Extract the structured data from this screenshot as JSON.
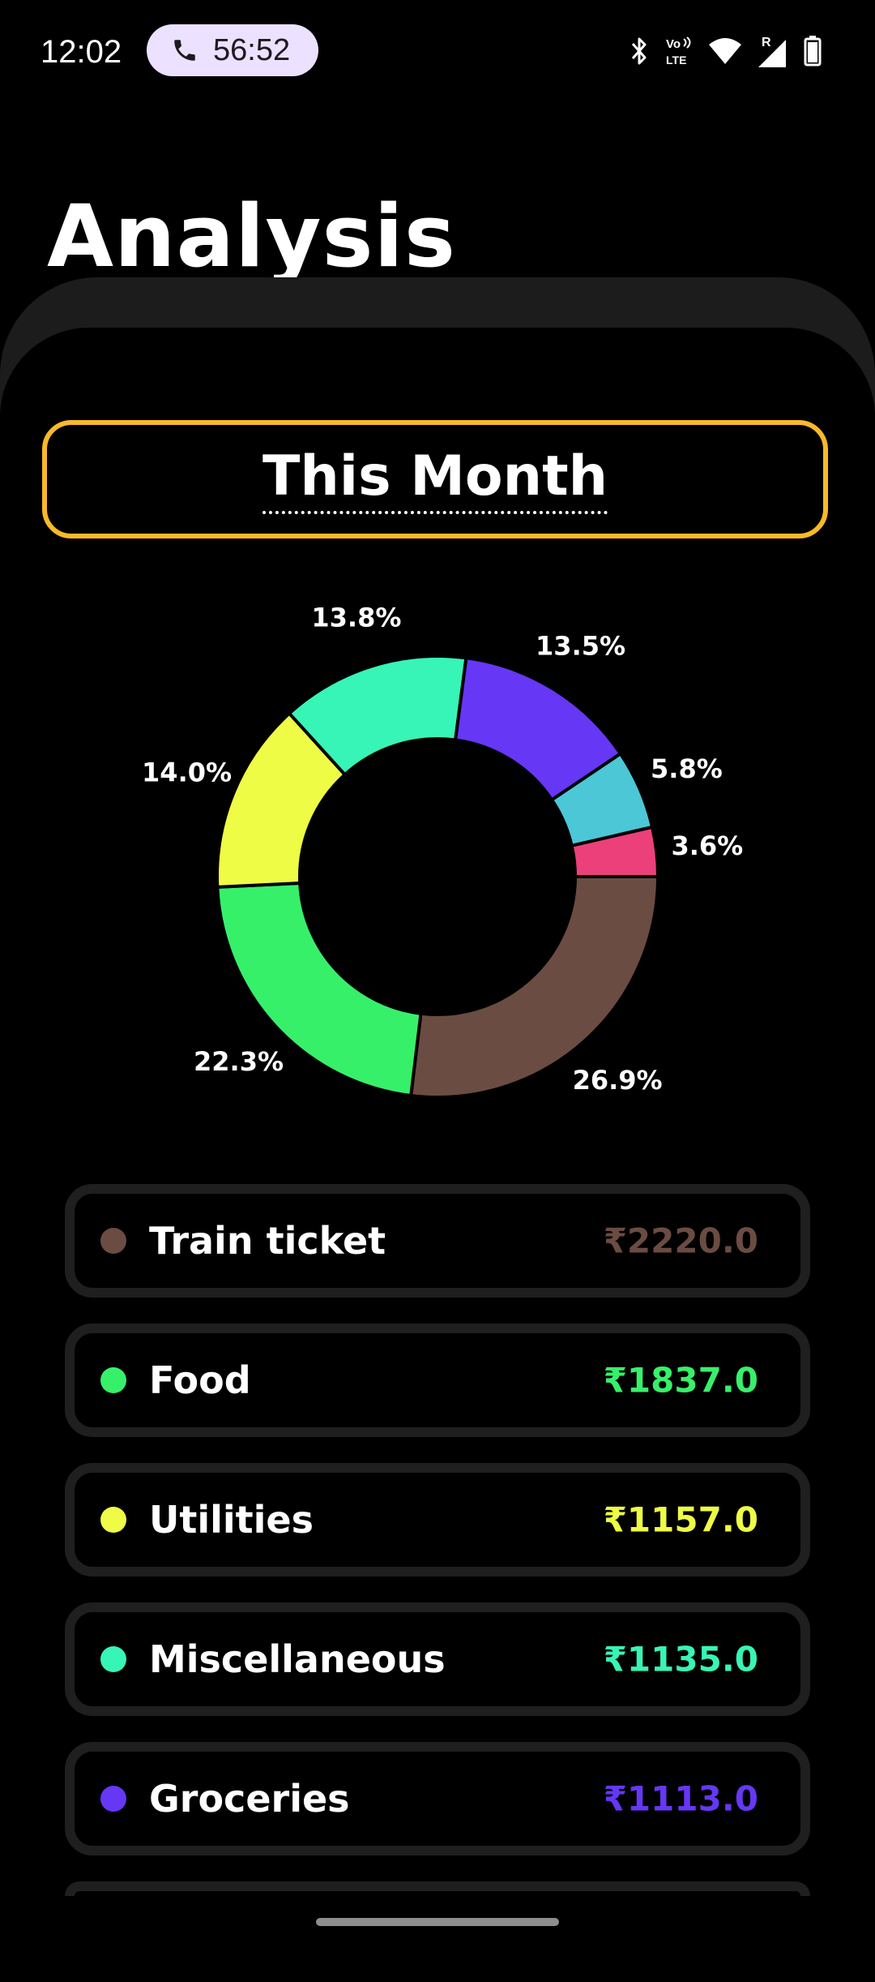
{
  "status_bar": {
    "time": "12:02",
    "call_timer": "56:52",
    "icons": [
      "phone-icon",
      "bluetooth-icon",
      "volte-icon",
      "wifi-icon",
      "signal-icon",
      "battery-icon"
    ],
    "volte_top": "Vo",
    "volte_bottom": "LTE",
    "roaming_indicator": "R"
  },
  "header": {
    "title": "Analysis"
  },
  "period_selector": {
    "label": "This Month",
    "border_color": "#fbb928"
  },
  "chart_data": {
    "type": "pie",
    "variant": "donut",
    "slices": [
      {
        "label": "Train ticket",
        "percent": 26.9,
        "percent_label": "26.9%",
        "color": "#6b4c42"
      },
      {
        "label": "Food",
        "percent": 22.3,
        "percent_label": "22.3%",
        "color": "#37f06a"
      },
      {
        "label": "Utilities",
        "percent": 14.0,
        "percent_label": "14.0%",
        "color": "#eefc45"
      },
      {
        "label": "Miscellaneous",
        "percent": 13.8,
        "percent_label": "13.8%",
        "color": "#37f5b6"
      },
      {
        "label": "Groceries",
        "percent": 13.5,
        "percent_label": "13.5%",
        "color": "#6637f5"
      },
      {
        "label": "",
        "percent": 5.8,
        "percent_label": "5.8%",
        "color": "#4bc7d6"
      },
      {
        "label": "",
        "percent": 3.6,
        "percent_label": "3.6%",
        "color": "#ec407a"
      }
    ]
  },
  "categories": [
    {
      "name": "Train ticket",
      "amount": "₹2220.0",
      "color": "#6b4c42"
    },
    {
      "name": "Food",
      "amount": "₹1837.0",
      "color": "#37f06a"
    },
    {
      "name": "Utilities",
      "amount": "₹1157.0",
      "color": "#eefc45"
    },
    {
      "name": "Miscellaneous",
      "amount": "₹1135.0",
      "color": "#37f5b6"
    },
    {
      "name": "Groceries",
      "amount": "₹1113.0",
      "color": "#6637f5"
    }
  ]
}
